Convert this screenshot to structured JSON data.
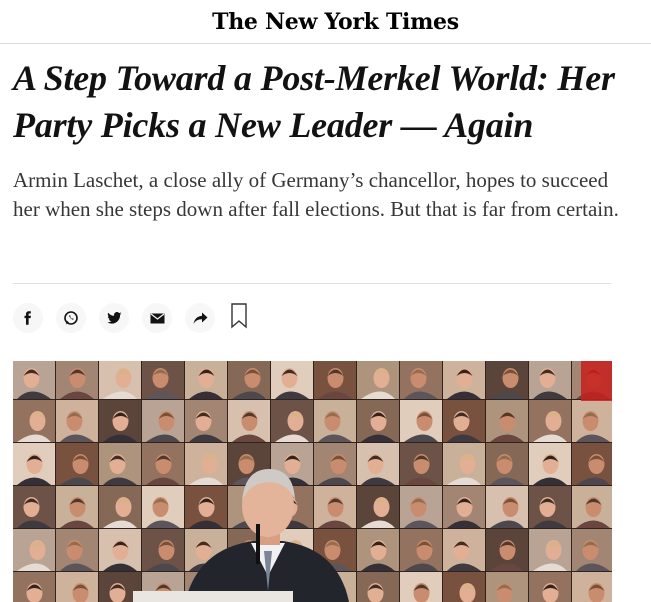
{
  "masthead": {
    "logo_text": "The New York Times"
  },
  "article": {
    "headline": "A Step Toward a Post-Merkel World: Her Party Picks a New Leader — Again",
    "summary": "Armin Laschet, a close ally of Germany’s chancellor, hopes to succeed her when she steps down after fall elections. But that is far from certain."
  },
  "share": {
    "buttons": [
      {
        "icon": "facebook-icon"
      },
      {
        "icon": "whatsapp-icon"
      },
      {
        "icon": "twitter-icon"
      },
      {
        "icon": "email-icon"
      },
      {
        "icon": "share-arrow-icon"
      }
    ],
    "bookmark_icon": "bookmark-icon"
  },
  "hero": {
    "description_icon": "photo",
    "colors": {
      "warm": "#d98e6a",
      "red": "#c8201e",
      "suit": "#3a3f4b"
    }
  }
}
